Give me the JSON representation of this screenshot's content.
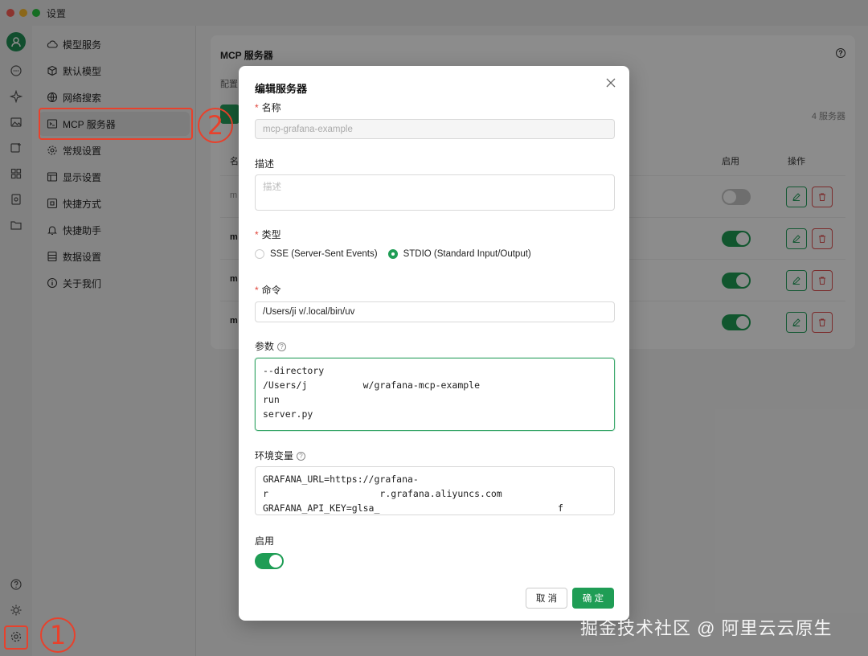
{
  "window": {
    "title": "设置"
  },
  "sidebar": {
    "items": [
      {
        "label": "模型服务",
        "icon": "cloud-icon"
      },
      {
        "label": "默认模型",
        "icon": "cube-icon"
      },
      {
        "label": "网络搜索",
        "icon": "globe-icon"
      },
      {
        "label": "MCP 服务器",
        "icon": "terminal-icon"
      },
      {
        "label": "常规设置",
        "icon": "gear-icon"
      },
      {
        "label": "显示设置",
        "icon": "display-icon"
      },
      {
        "label": "快捷方式",
        "icon": "command-icon"
      },
      {
        "label": "快捷助手",
        "icon": "bell-icon"
      },
      {
        "label": "数据设置",
        "icon": "database-icon"
      },
      {
        "label": "关于我们",
        "icon": "info-icon"
      }
    ]
  },
  "main": {
    "title": "MCP 服务器",
    "desc": "配置",
    "count": "4 服务器",
    "columns": {
      "name": "名",
      "enable": "启用",
      "ops": "操作"
    },
    "rows": [
      {
        "name": "m",
        "enabled": false
      },
      {
        "name": "m",
        "enabled": true
      },
      {
        "name": "m",
        "enabled": true
      },
      {
        "name": "m",
        "enabled": true
      }
    ]
  },
  "dialog": {
    "title": "编辑服务器",
    "name_label": "名称",
    "name_value": "mcp-grafana-example",
    "desc_label": "描述",
    "desc_placeholder": "描述",
    "type_label": "类型",
    "type_options": [
      "SSE (Server-Sent Events)",
      "STDIO (Standard Input/Output)"
    ],
    "type_selected": "STDIO (Standard Input/Output)",
    "command_label": "命令",
    "command_value": "/Users/ji           v/.local/bin/uv",
    "args_label": "参数",
    "args_value": "--directory\n/Users/j          w/grafana-mcp-example\nrun\nserver.py",
    "env_label": "环境变量",
    "env_value": "GRAFANA_URL=https://grafana-\nr                    r.grafana.aliyuncs.com\nGRAFANA_API_KEY=glsa_                                f",
    "enable_label": "启用",
    "enabled": true,
    "cancel_label": "取 消",
    "ok_label": "确 定"
  },
  "annotations": {
    "step1": "1",
    "step2": "2"
  },
  "watermark": "掘金技术社区 @ 阿里云云原生",
  "colors": {
    "accent": "#1f9d55",
    "danger": "#e05050",
    "annotation": "#e8412c"
  }
}
